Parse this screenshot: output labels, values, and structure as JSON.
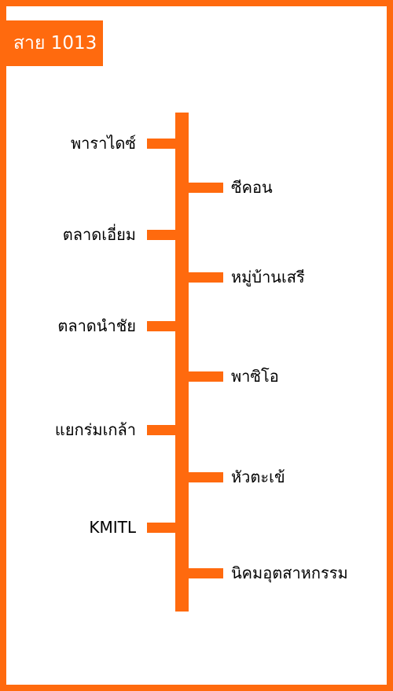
{
  "route": {
    "label": "สาย 1013"
  },
  "colors": {
    "accent": "#ff6a0e"
  },
  "stops": [
    {
      "name": "พาราไดซ์",
      "side": "left"
    },
    {
      "name": "ซีคอน",
      "side": "right"
    },
    {
      "name": "ตลาดเอี่ยม",
      "side": "left"
    },
    {
      "name": "หมู่บ้านเสรี",
      "side": "right"
    },
    {
      "name": "ตลาดนำชัย",
      "side": "left"
    },
    {
      "name": "พาซิโอ",
      "side": "right"
    },
    {
      "name": "แยกร่มเกล้า",
      "side": "left"
    },
    {
      "name": "หัวตะเข้",
      "side": "right"
    },
    {
      "name": "KMITL",
      "side": "left"
    },
    {
      "name": "นิคมอุตสาหกรรม",
      "side": "right"
    }
  ]
}
